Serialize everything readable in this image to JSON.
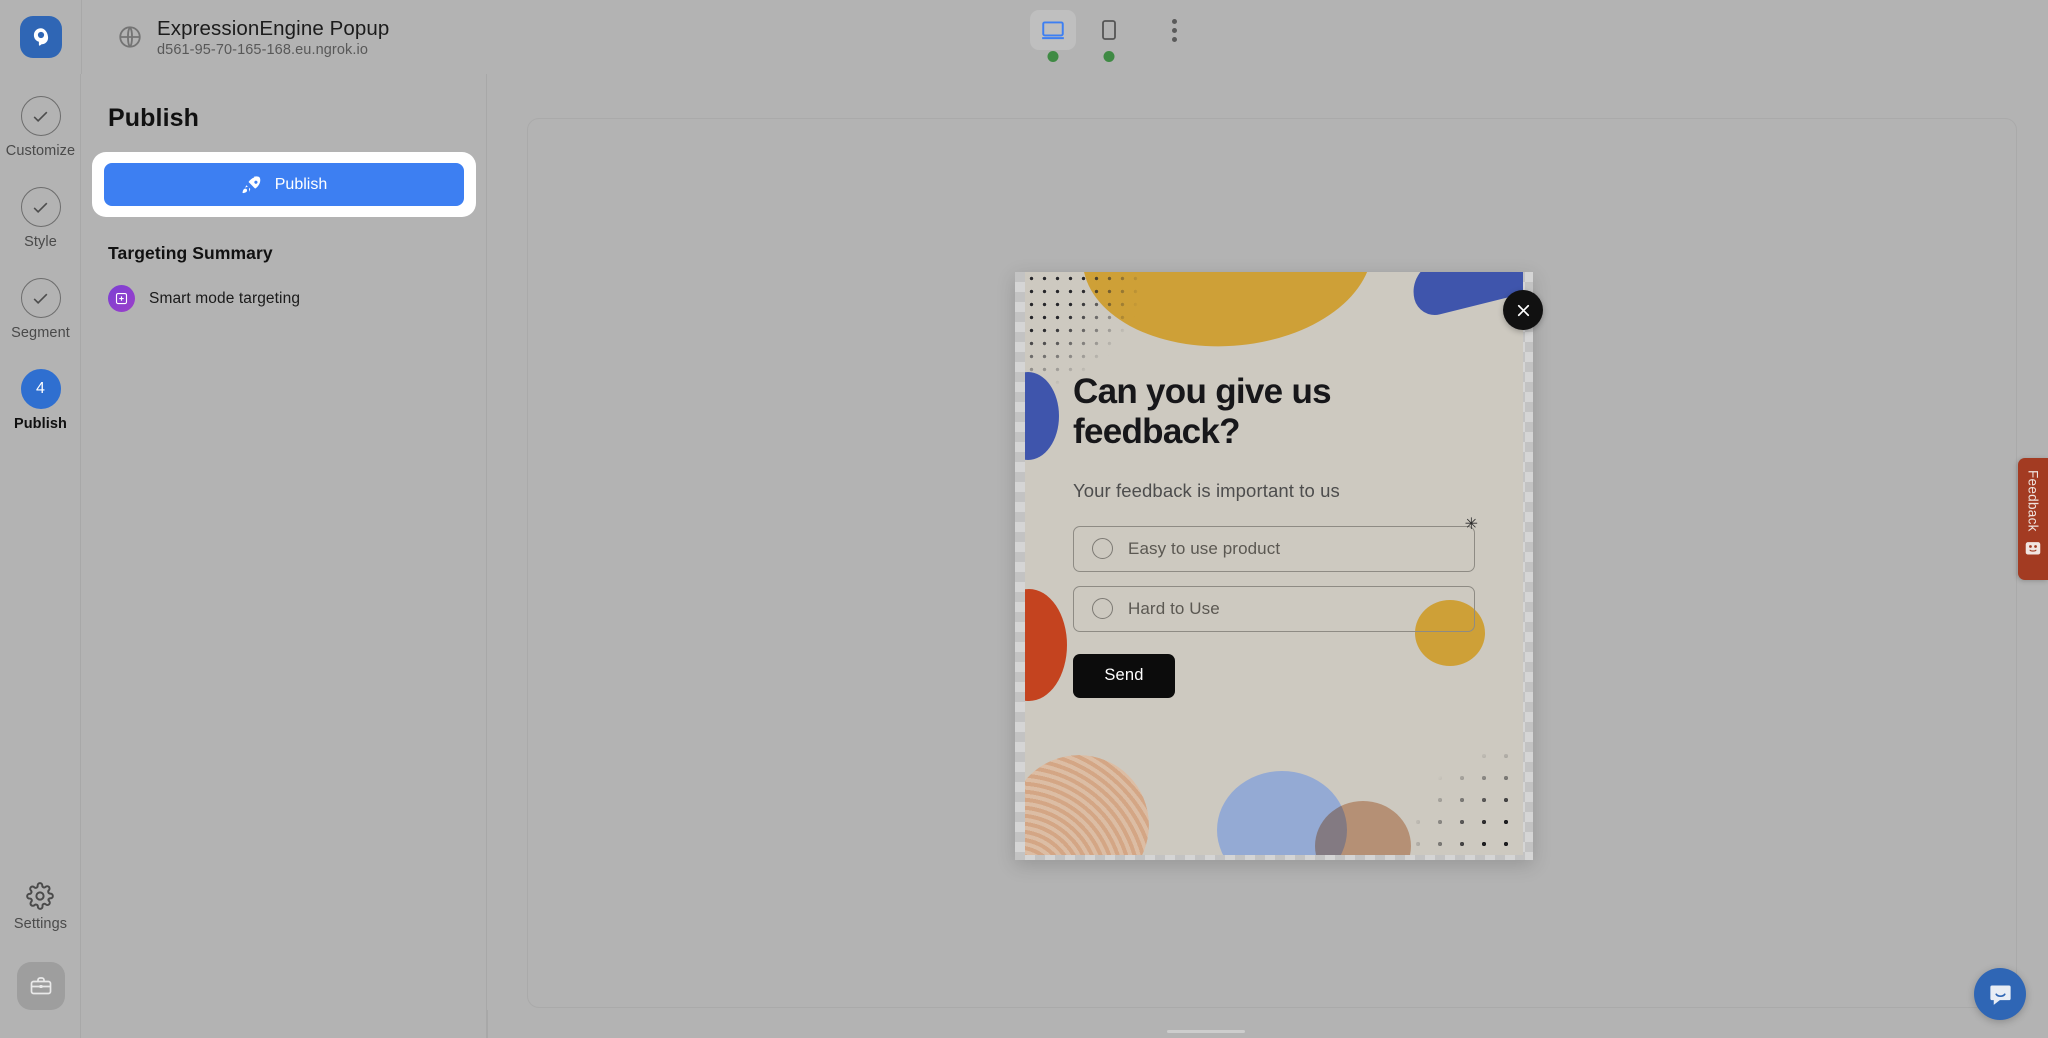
{
  "topbar": {
    "brand_icon": "popupsmart-logo-icon",
    "site_title": "ExpressionEngine Popup",
    "site_url": "d561-95-70-165-168.eu.ngrok.io",
    "globe_icon": "globe-icon",
    "devices": [
      {
        "name": "desktop",
        "icon": "desktop-icon",
        "active": true,
        "status": "online"
      },
      {
        "name": "mobile",
        "icon": "mobile-icon",
        "active": false,
        "status": "online"
      }
    ],
    "more_icon": "kebab-menu-icon"
  },
  "rail": {
    "steps": [
      {
        "label": "Customize",
        "state": "done",
        "icon": "check-circle-icon"
      },
      {
        "label": "Style",
        "state": "done",
        "icon": "check-circle-icon"
      },
      {
        "label": "Segment",
        "state": "done",
        "icon": "check-circle-icon"
      },
      {
        "label": "Publish",
        "state": "current",
        "number": "4"
      }
    ],
    "settings": {
      "label": "Settings",
      "icon": "gear-icon"
    },
    "briefcase": {
      "icon": "briefcase-icon"
    }
  },
  "panel": {
    "title": "Publish",
    "publish_button": {
      "label": "Publish",
      "icon": "rocket-icon"
    },
    "targeting_title": "Targeting Summary",
    "targeting_items": [
      {
        "label": "Smart mode targeting",
        "icon": "target-crosshair-icon"
      }
    ]
  },
  "popup": {
    "close_icon": "close-icon",
    "heading": "Can you give us feedback?",
    "subheading": "Your feedback is important to us",
    "options": [
      {
        "label": "Easy to use product",
        "icon": "radio-icon",
        "selected": false
      },
      {
        "label": "Hard to Use",
        "icon": "radio-icon",
        "selected": false
      }
    ],
    "send_button": "Send",
    "cursor_marker": "✳",
    "colors": {
      "background": "#cdc9c0",
      "gold": "#cea037",
      "blue": "#3f55ac",
      "red": "#c4431f",
      "light_blue": "#94aad4",
      "peach": "#ddab8b",
      "text": "#17171a",
      "button": "#0c0c0c"
    }
  },
  "feedback_tab": {
    "label": "Feedback",
    "icon": "smiley-face-icon",
    "color": "#a33b22"
  },
  "chat": {
    "icon": "chat-bubble-icon",
    "color": "#2f66b5"
  },
  "theme": {
    "accent": "#3d7ff2",
    "app_bg": "#b3b3b3",
    "status_online": "#3f8a44"
  }
}
